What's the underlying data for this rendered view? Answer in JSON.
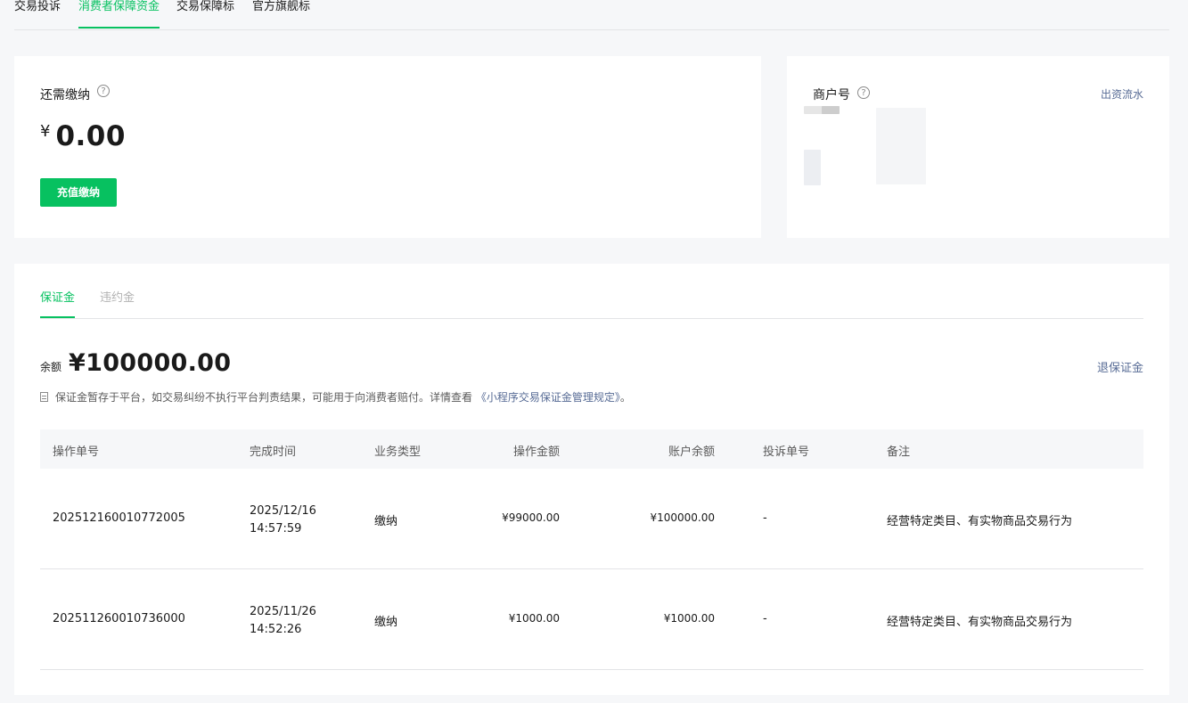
{
  "top_tabs": [
    "交易投诉",
    "消费者保障资金",
    "交易保障标",
    "官方旗舰标"
  ],
  "summary": {
    "label": "还需缴纳",
    "currency": "¥",
    "amount": "0.00",
    "button": "充值缴纳"
  },
  "merchant": {
    "label": "商户号",
    "link": "出资流水"
  },
  "deposit": {
    "tabs": [
      "保证金",
      "违约金"
    ],
    "balance_label": "余额",
    "balance_value": "¥100000.00",
    "refund_link": "退保证金",
    "note_text": "保证金暂存于平台，如交易纠纷不执行平台判责结果，可能用于向消费者赔付。详情查看",
    "note_link": "《小程序交易保证金管理规定》",
    "note_end": "。",
    "columns": [
      "操作单号",
      "完成时间",
      "业务类型",
      "操作金额",
      "账户余额",
      "投诉单号",
      "备注"
    ],
    "rows": [
      {
        "id": "202512160010772005",
        "time": "2025/12/16\n14:57:59",
        "type": "缴纳",
        "amount": "¥99000.00",
        "balance": "¥100000.00",
        "complaint": "-",
        "remark": "经营特定类目、有实物商品交易行为"
      },
      {
        "id": "202511260010736000",
        "time": "2025/11/26\n14:52:26",
        "type": "缴纳",
        "amount": "¥1000.00",
        "balance": "¥1000.00",
        "complaint": "-",
        "remark": "经营特定类目、有实物商品交易行为"
      }
    ]
  },
  "colors": {
    "accent": "#07c160",
    "link": "#576b95"
  },
  "icons": [
    "help-icon",
    "document-icon"
  ]
}
